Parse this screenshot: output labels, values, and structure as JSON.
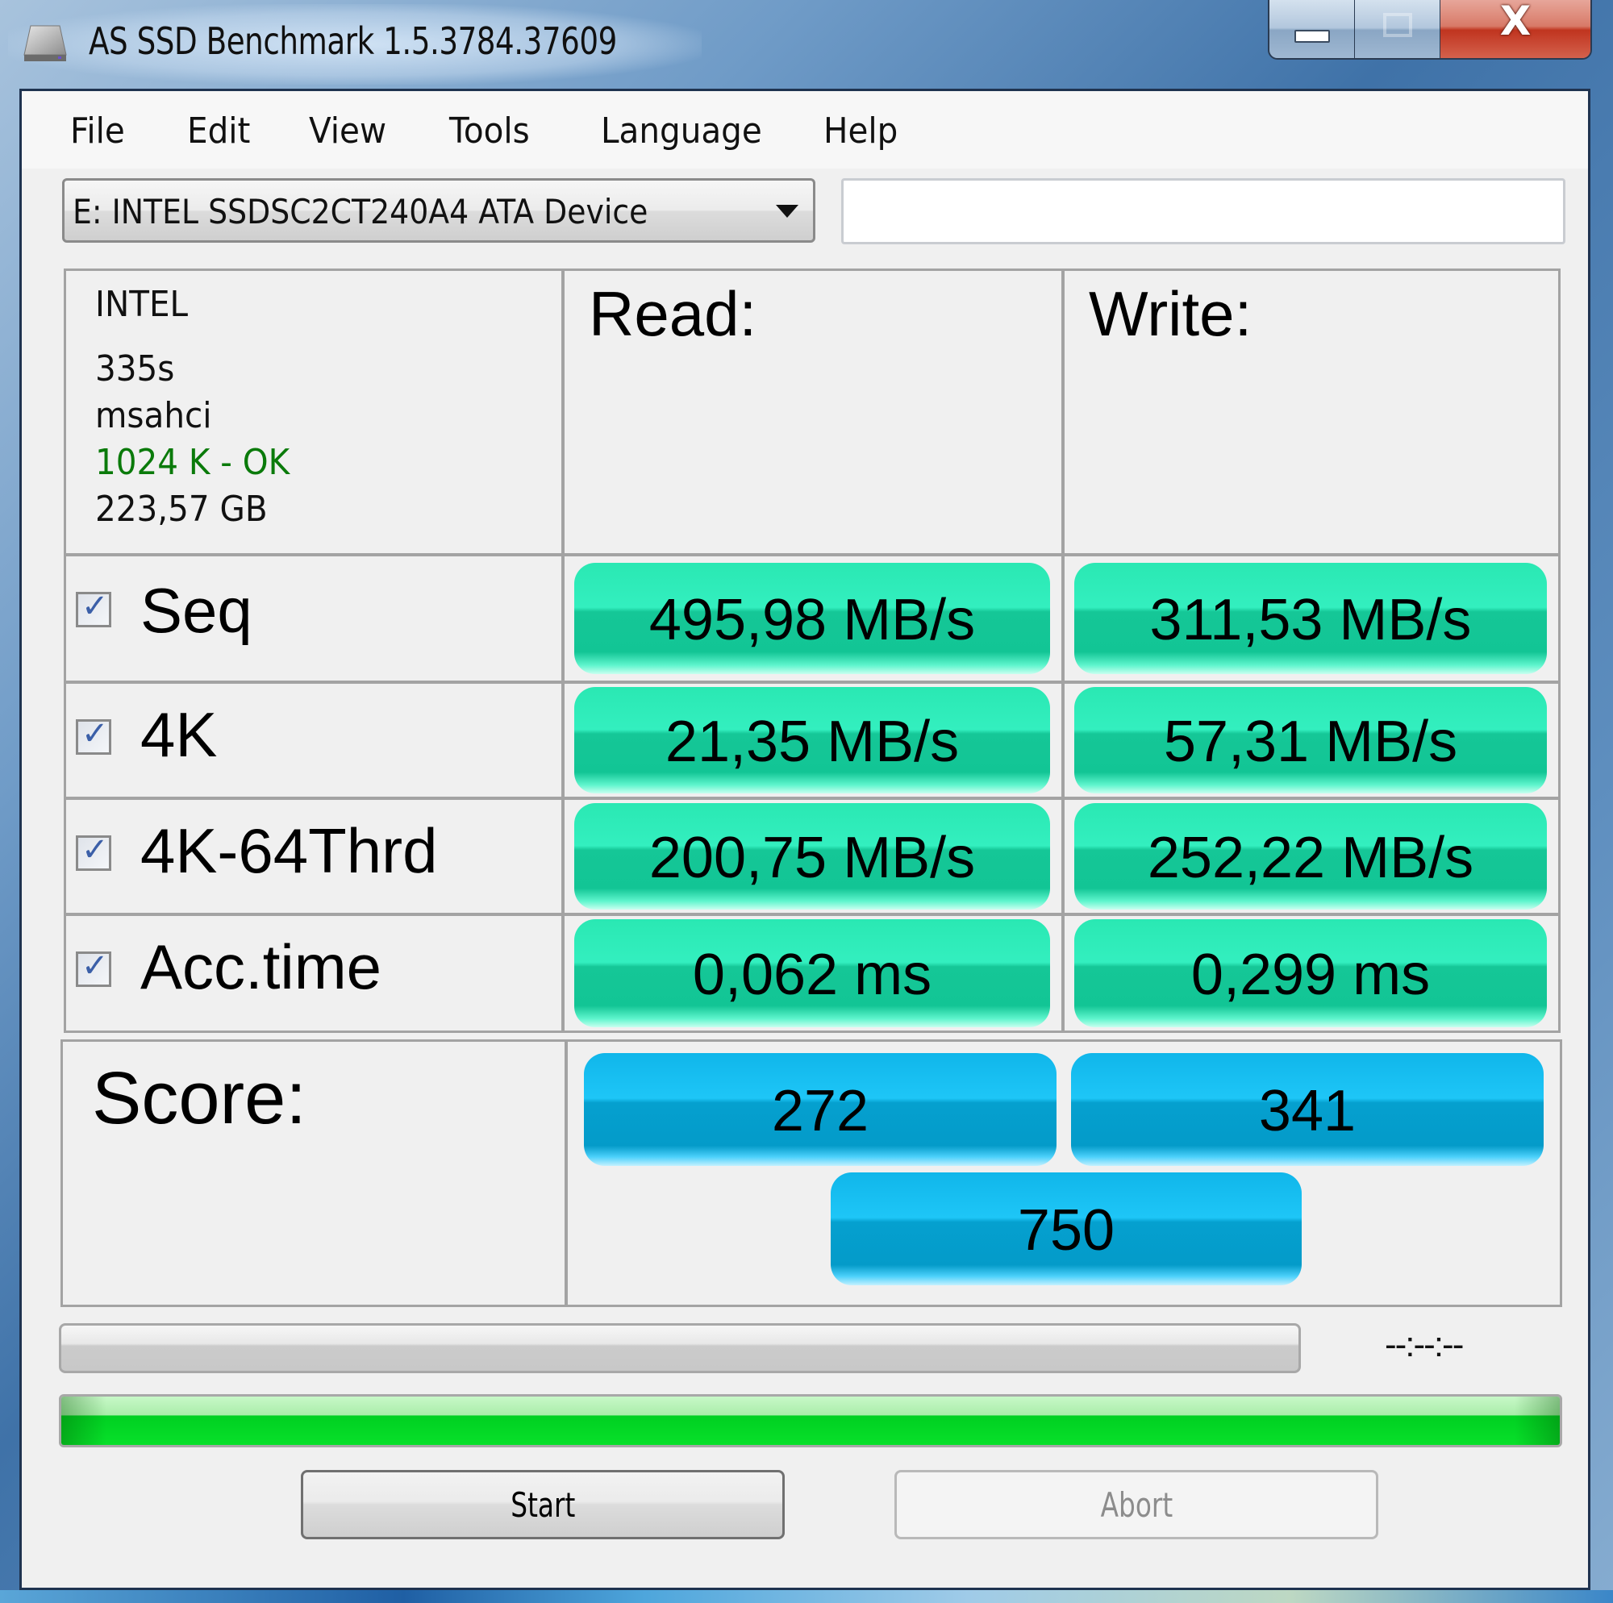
{
  "window": {
    "title": "AS SSD Benchmark 1.5.3784.37609",
    "controls": {
      "minimize_icon": "minimize-icon",
      "maximize_icon": "maximize-icon",
      "close_icon": "close-icon",
      "close_glyph": "X"
    }
  },
  "menu": [
    "File",
    "Edit",
    "View",
    "Tools",
    "Language",
    "Help"
  ],
  "drive_select": {
    "value": "E: INTEL SSDSC2CT240A4 ATA Device"
  },
  "path_field": {
    "value": ""
  },
  "drive_info": {
    "vendor": "INTEL",
    "firmware": "335s",
    "driver": "msahci",
    "alignment": "1024 K - OK",
    "capacity": "223,57 GB",
    "alignment_color": "#0a7a0a"
  },
  "columns": {
    "read": "Read:",
    "write": "Write:"
  },
  "tests": [
    {
      "label": "Seq",
      "checked": true,
      "read": "495,98 MB/s",
      "write": "311,53 MB/s"
    },
    {
      "label": "4K",
      "checked": true,
      "read": "21,35 MB/s",
      "write": "57,31 MB/s"
    },
    {
      "label": "4K-64Thrd",
      "checked": true,
      "read": "200,75 MB/s",
      "write": "252,22 MB/s"
    },
    {
      "label": "Acc.time",
      "checked": true,
      "read": "0,062 ms",
      "write": "0,299 ms"
    }
  ],
  "score": {
    "label": "Score:",
    "read": "272",
    "write": "341",
    "total": "750"
  },
  "progress": {
    "timer": "--:--:--",
    "overall_fraction": 1.0
  },
  "buttons": {
    "start": "Start",
    "abort": "Abort"
  },
  "colors": {
    "result_green": "#1ec99a",
    "score_blue": "#0aa8dc",
    "progress_green": "#00d021"
  }
}
